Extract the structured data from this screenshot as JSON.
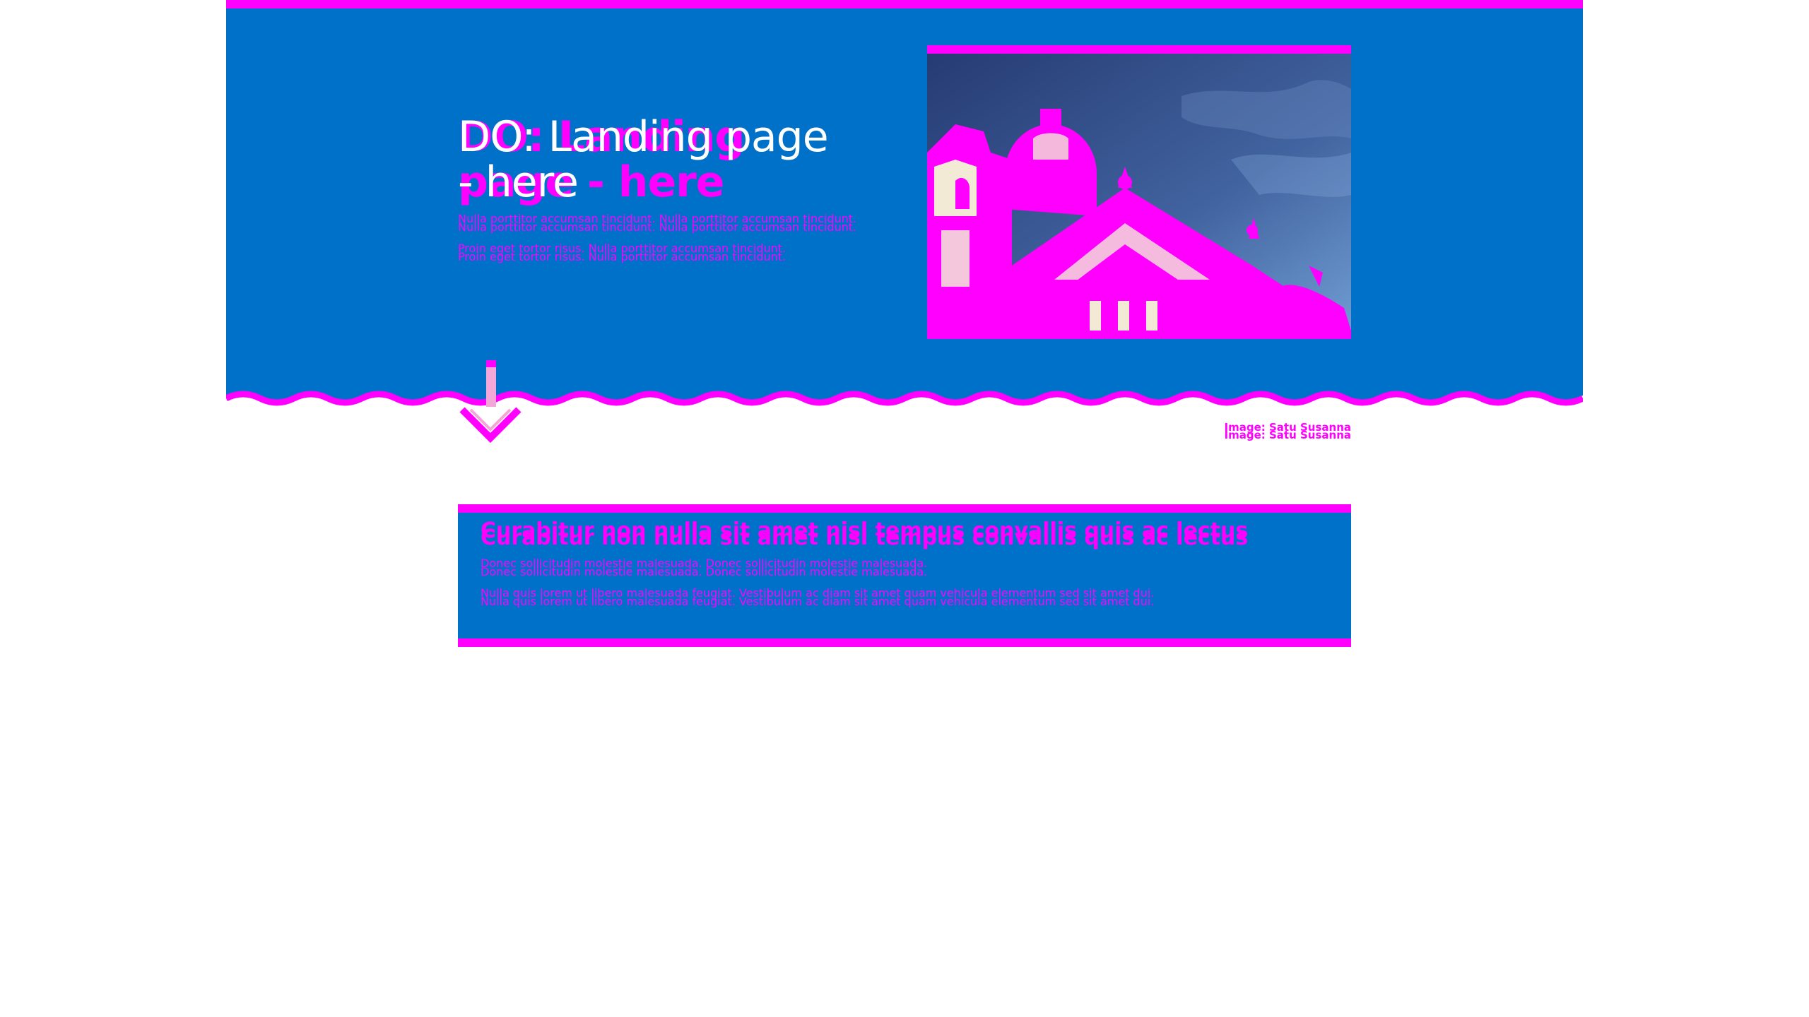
{
  "hero": {
    "title": "DO: Landing page - here",
    "lead_1": "Nulla porttitor accumsan tincidunt. Nulla porttitor accumsan tincidunt.",
    "lead_2": "Proin eget tortor risus. Nulla porttitor accumsan tincidunt.",
    "image_alt": "Building facade against blue sky",
    "image_credit": "Image: Satu Susanna"
  },
  "info": {
    "title": "Curabitur non nulla sit amet nisl tempus convallis quis ac lectus",
    "text_1": "Donec sollicitudin molestie malesuada. Donec sollicitudin molestie malesuada.",
    "text_2": "Nulla quis lorem ut libero malesuada feugiat. Vestibulum ac diam sit amet quam vehicula elementum sed sit amet dui."
  },
  "colors": {
    "primary_blue": "#0071c8",
    "accent_magenta": "#ff00ff",
    "arrow_pink": "#f3a6d8",
    "background": "#ffffff"
  },
  "icons": {
    "scroll_down": "arrow-down-icon"
  }
}
